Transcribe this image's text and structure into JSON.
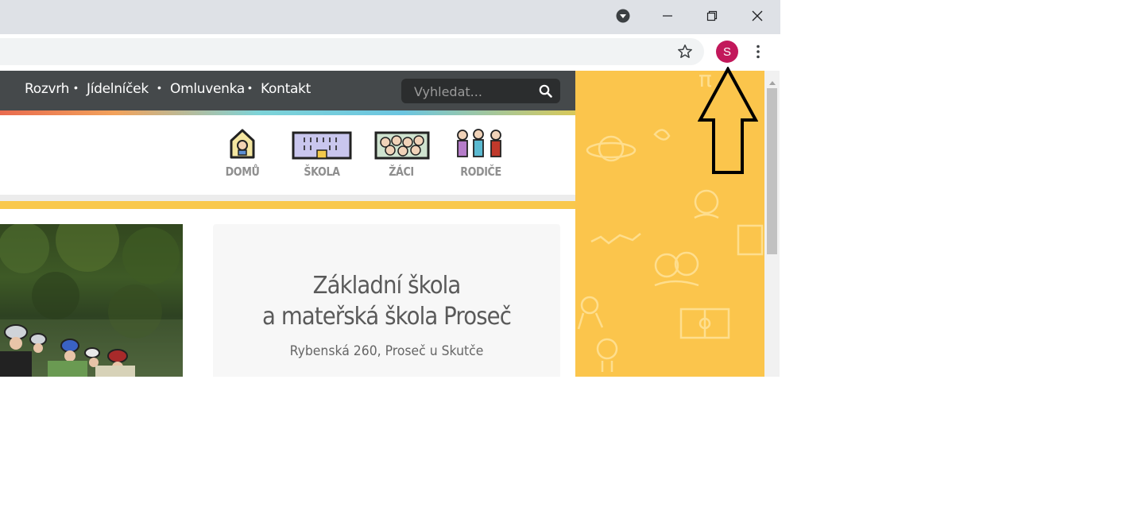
{
  "window": {
    "controls": {
      "minimize_icon": "minimize-icon",
      "restore_icon": "restore-icon",
      "close_icon": "close-icon",
      "tab_search_icon": "tab-search-icon"
    }
  },
  "toolbar": {
    "bookmark_icon": "star-icon",
    "profile_initial": "S",
    "profile_color": "#c2185b",
    "menu_icon": "more-vert-icon"
  },
  "site": {
    "nav": [
      "Rozvrh",
      "Jídelníček",
      "Omluvenka",
      "Kontakt"
    ],
    "search": {
      "placeholder": "Vyhledat..."
    },
    "menu": [
      {
        "label": "DOMŮ",
        "icon": "house-icon"
      },
      {
        "label": "ŠKOLA",
        "icon": "school-building-icon"
      },
      {
        "label": "ŽÁCI",
        "icon": "pupils-icon"
      },
      {
        "label": "RODIČE",
        "icon": "parents-icon"
      }
    ],
    "card": {
      "title_line1": "Základní škola",
      "title_line2": "a mateřská škola Proseč",
      "address": "Rybenská 260, Proseč u Skutče"
    }
  },
  "colors": {
    "navbar": "#45494b",
    "side_panel": "#fbc54c",
    "menu_label": "#8f8f8f"
  }
}
